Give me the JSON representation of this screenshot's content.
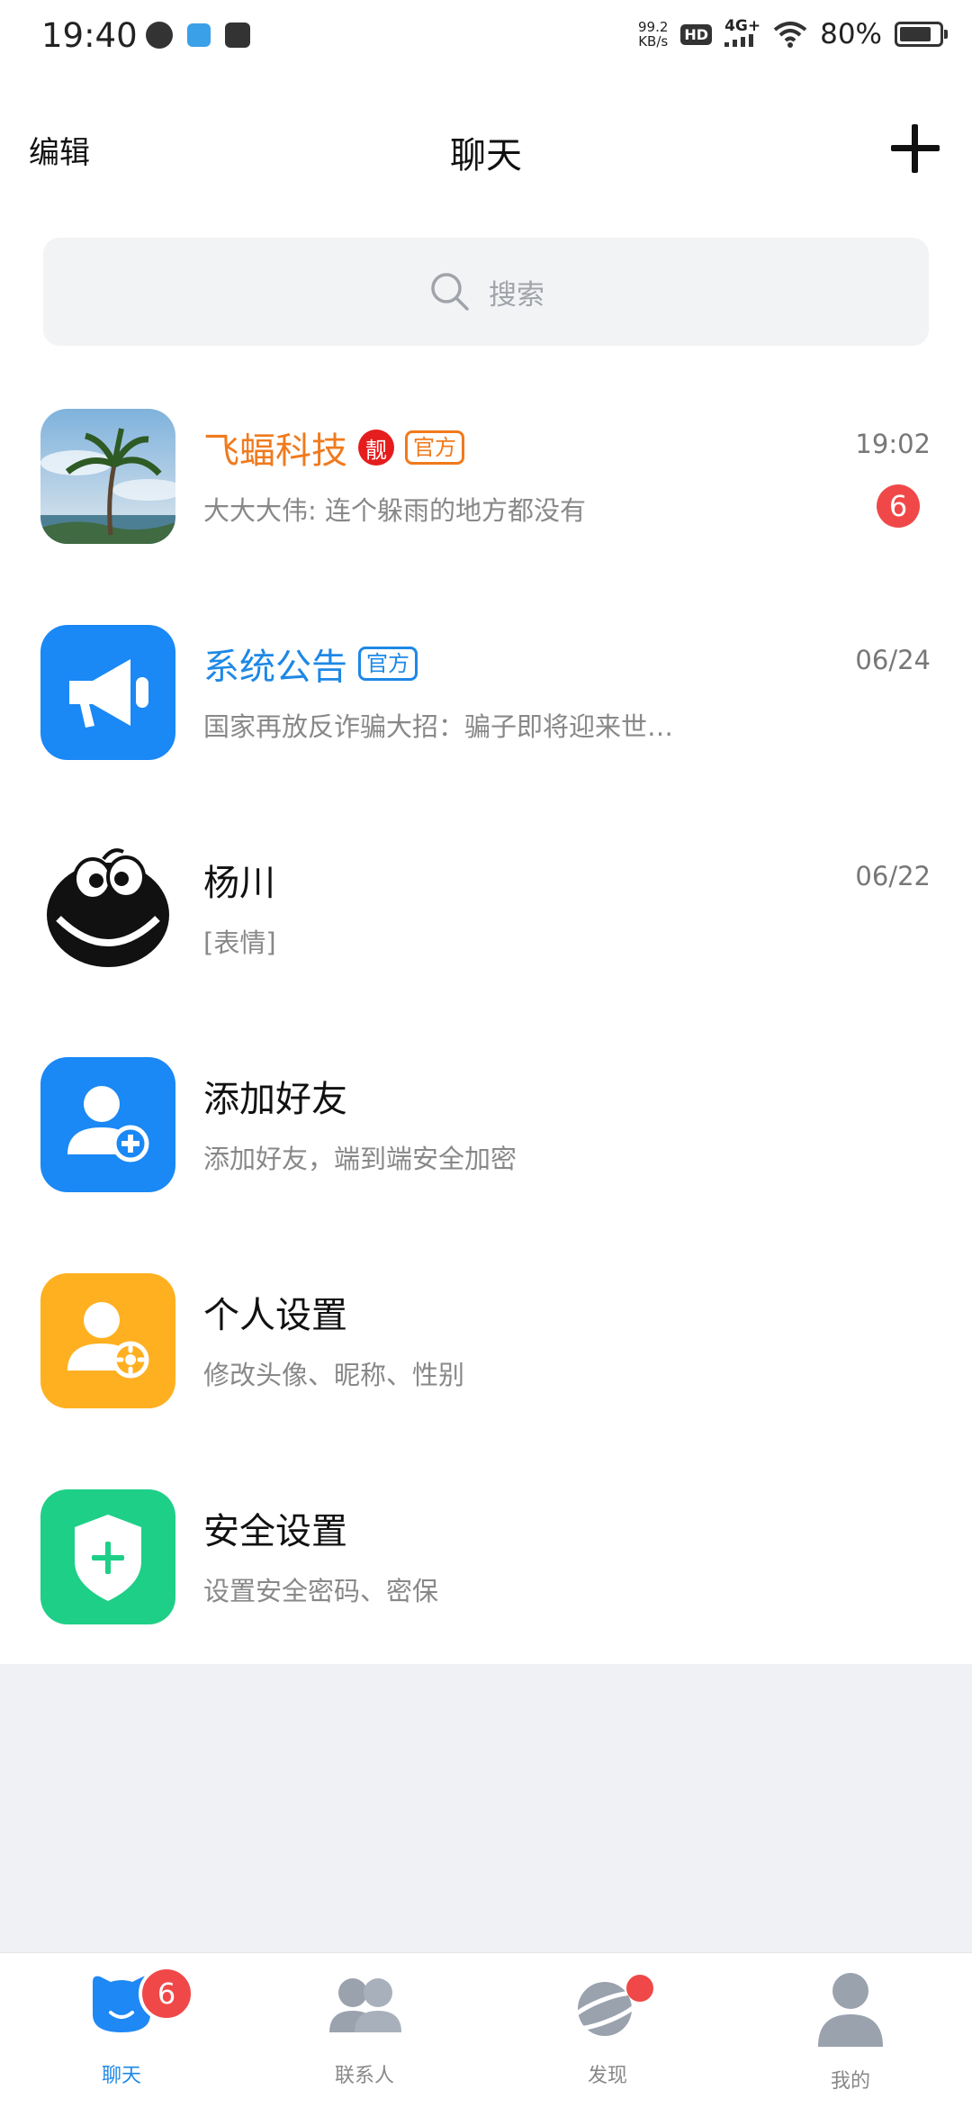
{
  "status_bar": {
    "time": "19:40",
    "net_speed_value": "99.2",
    "net_speed_unit": "KB/s",
    "hd": "HD",
    "network": "4G+",
    "battery_text": "80%",
    "battery_level": 0.8
  },
  "header": {
    "edit_label": "编辑",
    "title": "聊天"
  },
  "search": {
    "placeholder": "搜索"
  },
  "chats": [
    {
      "name": "飞蝠科技",
      "badge": "靓",
      "tag": "官方",
      "preview": "大大大伟: 连个躲雨的地方都没有",
      "time": "19:02",
      "unread": "6"
    },
    {
      "name": "系统公告",
      "tag": "官方",
      "preview": "国家再放反诈骗大招：骗子即将迎来世…",
      "time": "06/24"
    },
    {
      "name": "杨川",
      "preview": "[表情]",
      "time": "06/22"
    },
    {
      "name": "添加好友",
      "preview": "添加好友，端到端安全加密"
    },
    {
      "name": "个人设置",
      "preview": "修改头像、昵称、性别"
    },
    {
      "name": "安全设置",
      "preview": "设置安全密码、密保"
    }
  ],
  "colors": {
    "accent_blue": "#1e88e5",
    "orange": "#f07a1d",
    "amber": "#ffb020",
    "green": "#22cc88",
    "badge_red": "#f04848"
  },
  "bottom_nav": {
    "items": [
      {
        "label": "聊天",
        "badge": "6",
        "active": true
      },
      {
        "label": "联系人"
      },
      {
        "label": "发现"
      },
      {
        "label": "我的"
      }
    ]
  }
}
